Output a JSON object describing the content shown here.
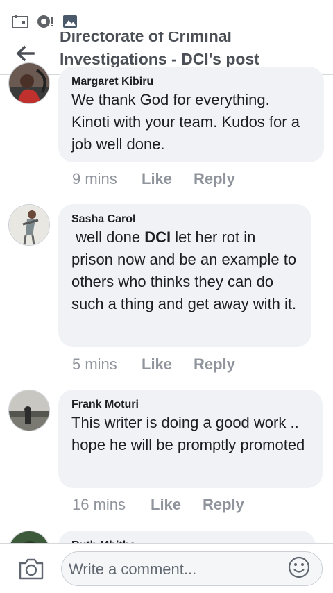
{
  "header": {
    "title_line1": "Directorate of Criminal",
    "title_line2": "Investigations - DCI's post"
  },
  "comments": [
    {
      "author": "Margaret Kibiru",
      "text": "We thank God for everything. Kinoti with your team. Kudos for a job well done.",
      "time": "9 mins",
      "like": "Like",
      "reply": "Reply"
    },
    {
      "author": "Sasha Carol",
      "text_before": " well done ",
      "text_bold": "DCI",
      "text_after": " let her rot in prison now and be an example to others who thinks they can do such a thing and get away with it.",
      "time": "5 mins",
      "like": "Like",
      "reply": "Reply"
    },
    {
      "author": "Frank Moturi",
      "text": "This writer is doing a good work .. hope he will be promptly promoted",
      "time": "16 mins",
      "like": "Like",
      "reply": "Reply"
    },
    {
      "author": "Ruth Mbithe"
    }
  ],
  "composer": {
    "placeholder": "Write a comment..."
  },
  "icons": {
    "status": [
      "calendar-icon",
      "messenger-icon",
      "photo-icon"
    ],
    "back": "back-arrow-icon",
    "camera": "camera-icon",
    "emoji": "smiley-icon"
  }
}
